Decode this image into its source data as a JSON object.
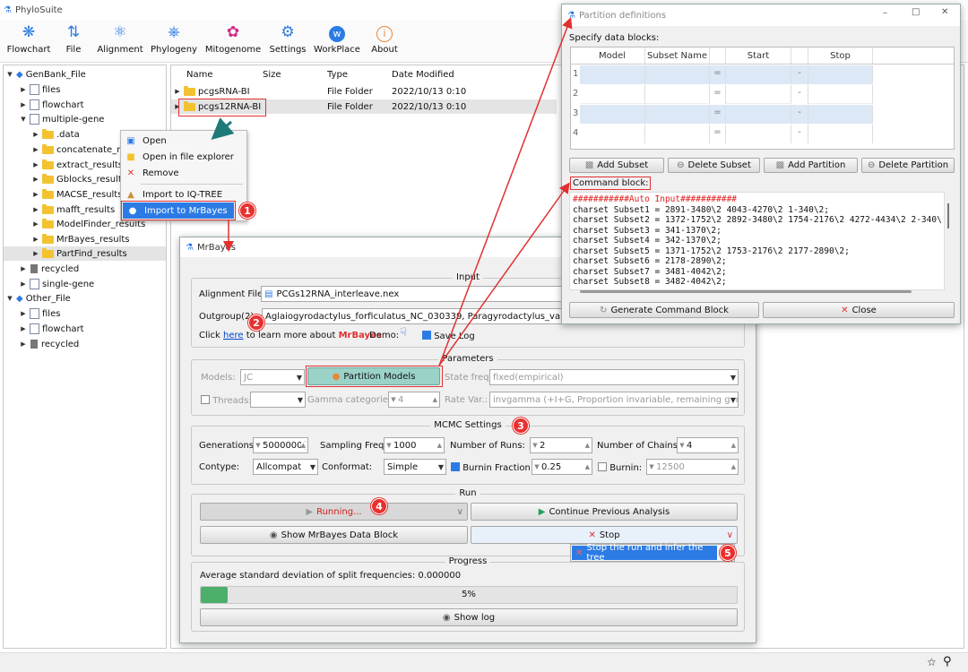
{
  "app": {
    "title": "PhyloSuite"
  },
  "toolbar": [
    {
      "label": "Flowchart",
      "icon": "flowchart-icon"
    },
    {
      "label": "File",
      "icon": "file-icon"
    },
    {
      "label": "Alignment",
      "icon": "alignment-icon"
    },
    {
      "label": "Phylogeny",
      "icon": "phylogeny-icon"
    },
    {
      "label": "Mitogenome",
      "icon": "mitogenome-icon"
    },
    {
      "label": "Settings",
      "icon": "settings-icon"
    },
    {
      "label": "WorkPlace",
      "icon": "workplace-icon"
    },
    {
      "label": "About",
      "icon": "about-icon"
    }
  ],
  "tree": {
    "genbank": "GenBank_File",
    "files": "files",
    "flowchart": "flowchart",
    "multiple_gene": "multiple-gene",
    "data": ".data",
    "concatenate": "concatenate_res",
    "extract": "extract_results",
    "gblocks": "Gblocks_results",
    "macse": "MACSE_results",
    "mafft": "mafft_results",
    "modelfinder": "ModelFinder_results",
    "mrbayes": "MrBayes_results",
    "partfind": "PartFind_results",
    "recycled": "recycled",
    "single_gene": "single-gene",
    "other": "Other_File",
    "files2": "files",
    "flowchart2": "flowchart",
    "recycled2": "recycled"
  },
  "files_table": {
    "headers": [
      "Name",
      "Size",
      "Type",
      "Date Modified"
    ],
    "rows": [
      {
        "name": "pcgsRNA-BI",
        "type": "File Folder",
        "date": "2022/10/13 0:10"
      },
      {
        "name": "pcgs12RNA-BI",
        "type": "File Folder",
        "date": "2022/10/13 0:10"
      }
    ]
  },
  "context_menu": [
    "Open",
    "Open in file explorer",
    "Remove",
    "Import to IQ-TREE",
    "Import to MrBayes"
  ],
  "mrbayes": {
    "title": "MrBayes",
    "input": {
      "group": "Input",
      "alignment_label": "Alignment File:",
      "alignment_value": "PCGs12RNA_interleave.nex",
      "outgroup_label": "Outgroup(2):",
      "outgroup_value": "Aglaiogyrodactylus_forficulatus_NC_030339, Paragyrodactylus_variegatus_NC_",
      "click": "Click",
      "here": "here",
      "learn": "to learn more about",
      "mrbayes": "MrBayes",
      "demo": "Demo:",
      "save_log": "Save Log"
    },
    "params": {
      "group": "Parameters",
      "models_label": "Models:",
      "models_value": "JC",
      "partition_btn": "Partition Models",
      "state_label": "State freq:",
      "state_value": "fixed(empirical)",
      "threads_label": "Threads:",
      "gamma_label": "Gamma categories:",
      "gamma_value": "4",
      "rate_label": "Rate Var.:",
      "rate_value": "invgamma (+I+G, Proportion invariable, remaining gamma)"
    },
    "mcmc": {
      "group": "MCMC Settings",
      "gen_label": "Generations:",
      "gen_value": "5000000(",
      "sf_label": "Sampling Freq:",
      "sf_value": "1000",
      "runs_label": "Number of Runs:",
      "runs_value": "2",
      "chains_label": "Number of Chains:",
      "chains_value": "4",
      "contype_label": "Contype:",
      "contype_value": "Allcompat",
      "conformat_label": "Conformat:",
      "conformat_value": "Simple",
      "burnin_frac_label": "Burnin Fraction:",
      "burnin_frac_value": "0.25",
      "burnin_label": "Burnin:",
      "burnin_value": "12500"
    },
    "run": {
      "group": "Run",
      "running": "Running...",
      "continue": "Continue Previous Analysis",
      "show_block": "Show MrBayes Data Block",
      "stop": "Stop",
      "stop_menu": "Stop the run and infer the tree"
    },
    "progress": {
      "group": "Progress",
      "avg_text": "Average standard deviation of split frequencies: 0.000000",
      "percent_text": "5%",
      "percent": 0.05,
      "show_log": "Show log"
    }
  },
  "partition": {
    "title": "Partition definitions",
    "specify": "Specify data blocks:",
    "headers": [
      "Model",
      "Subset Name",
      "",
      "Start",
      "",
      "Stop"
    ],
    "rows": [
      "1",
      "2",
      "3",
      "4"
    ],
    "eq": "=",
    "dash": "-",
    "add_subset": "Add Subset",
    "delete_subset": "Delete Subset",
    "add_partition": "Add Partition",
    "delete_partition": "Delete Partition",
    "command_label": "Command block:",
    "command_lines": [
      "###########Auto Input###########",
      "charset Subset1 = 2891-3480\\2 4043-4270\\2 1-340\\2;",
      "charset Subset2 = 1372-1752\\2 2892-3480\\2 1754-2176\\2 4272-4434\\2 2-340\\",
      "charset Subset3 = 341-1370\\2;",
      "charset Subset4 = 342-1370\\2;",
      "charset Subset5 = 1371-1752\\2 1753-2176\\2 2177-2890\\2;",
      "charset Subset6 = 2178-2890\\2;",
      "charset Subset7 = 3481-4042\\2;",
      "charset Subset8 = 3482-4042\\2;"
    ],
    "generate": "Generate Command Block",
    "close": "Close"
  },
  "badges": [
    "1",
    "2",
    "3",
    "4",
    "5"
  ],
  "colors": {
    "accent": "#2c7be5",
    "badge": "#e8302f",
    "progress": "#4caf6a",
    "selection": "#cfe3f7"
  }
}
